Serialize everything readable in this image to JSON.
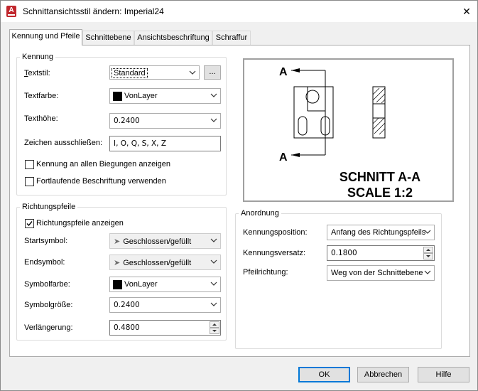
{
  "window": {
    "title": "Schnittansichtsstil ändern: Imperial24",
    "close_label": "✕"
  },
  "tabs": [
    {
      "label": "Kennung und Pfeile",
      "active": true
    },
    {
      "label": "Schnittebene",
      "active": false
    },
    {
      "label": "Ansichtsbeschriftung",
      "active": false
    },
    {
      "label": "Schraffur",
      "active": false
    }
  ],
  "kennung": {
    "title": "Kennung",
    "textstil_label": "Textstil:",
    "textstil_value": "Standard",
    "browse_label": "...",
    "textfarbe_label": "Textfarbe:",
    "textfarbe_value": "VonLayer",
    "texthoehe_label": "Texthöhe:",
    "texthoehe_value": "0.2400",
    "zeichen_label": "Zeichen ausschließen:",
    "zeichen_value": "I, O, Q, S, X, Z",
    "alle_biegungen_label": "Kennung an allen Biegungen anzeigen",
    "alle_biegungen_checked": false,
    "fortlaufend_label": "Fortlaufende Beschriftung verwenden",
    "fortlaufend_checked": false
  },
  "richtungspfeile": {
    "title": "Richtungspfeile",
    "anzeigen_label": "Richtungspfeile anzeigen",
    "anzeigen_checked": true,
    "startsymbol_label": "Startsymbol:",
    "startsymbol_value": "Geschlossen/gefüllt",
    "endsymbol_label": "Endsymbol:",
    "endsymbol_value": "Geschlossen/gefüllt",
    "symbolfarbe_label": "Symbolfarbe:",
    "symbolfarbe_value": "VonLayer",
    "symbolgroesse_label": "Symbolgröße:",
    "symbolgroesse_value": "0.2400",
    "verlaengerung_label": "Verlängerung:",
    "verlaengerung_value": "0.4800"
  },
  "preview": {
    "label_a_top": "A",
    "label_a_bottom": "A",
    "caption_line1": "SCHNITT A-A",
    "caption_line2": "SCALE 1:2"
  },
  "anordnung": {
    "title": "Anordnung",
    "position_label": "Kennungsposition:",
    "position_value": "Anfang des Richtungspfeils",
    "versatz_label": "Kennungsversatz:",
    "versatz_value": "0.1800",
    "richtung_label": "Pfeilrichtung:",
    "richtung_value": "Weg von der Schnittebene"
  },
  "buttons": {
    "ok": "OK",
    "cancel": "Abbrechen",
    "help": "Hilfe"
  },
  "colors": {
    "accent": "#0078d7",
    "swatch": "#000000",
    "app_icon": "#c1272d"
  }
}
